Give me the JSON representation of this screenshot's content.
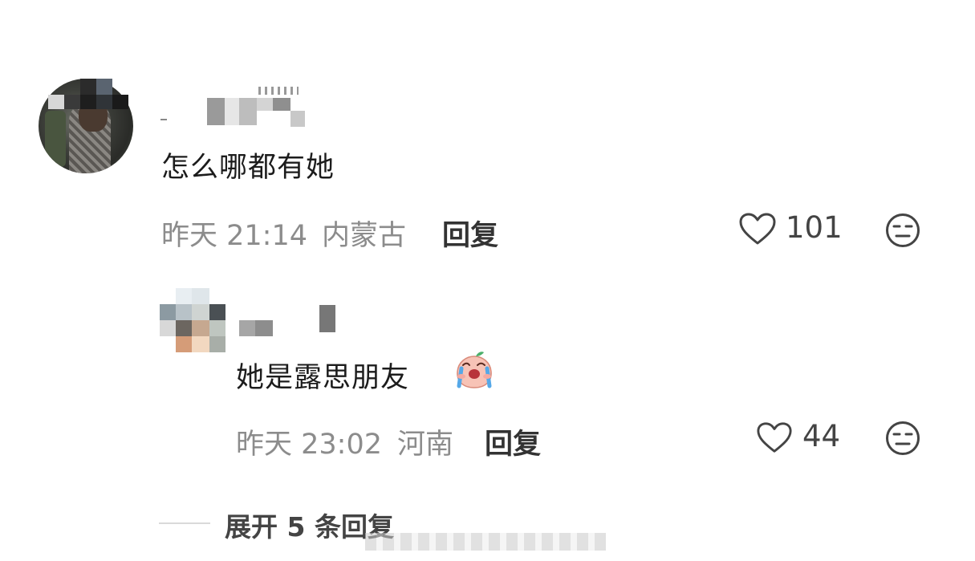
{
  "comment": {
    "text": "怎么哪都有她",
    "time": "昨天 21:14",
    "location": "内蒙古",
    "reply_label": "回复",
    "likes": "101",
    "reply": {
      "text": "她是露思朋友",
      "emoji_icon": "crying-peach-emoji",
      "time": "昨天 23:02",
      "location": "河南",
      "reply_label": "回复",
      "likes": "44"
    },
    "expand_label": "展开 5 条回复"
  },
  "icons": {
    "like": "heart-outline-icon",
    "dislike": "meh-face-icon"
  },
  "colors": {
    "meta_text": "#8c8c8c",
    "body_text": "#1c1c1c",
    "icon_stroke": "#444444"
  }
}
